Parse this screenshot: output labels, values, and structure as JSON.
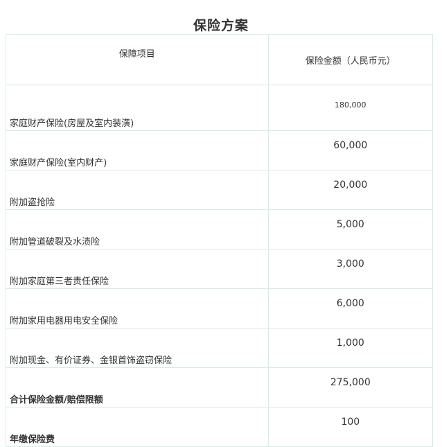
{
  "title": "保险方案",
  "table": {
    "header": {
      "item": "保障项目",
      "amount": "保险金额（人民币元）"
    },
    "rows": [
      {
        "item": "家庭财产保险(房屋及室内装潢)",
        "amount": "180,000",
        "bold": false
      },
      {
        "item": "家庭财产保险(室内财产)",
        "amount": "60,000",
        "bold": false
      },
      {
        "item": "附加盗抢险",
        "amount": "20,000",
        "bold": false
      },
      {
        "item": "附加管道破裂及水渍险",
        "amount": "5,000",
        "bold": false
      },
      {
        "item": "附加家庭第三者责任保险",
        "amount": "3,000",
        "bold": false
      },
      {
        "item": "附加家用电器用电安全保险",
        "amount": "6,000",
        "bold": false
      },
      {
        "item": "附加现金、有价证券、金银首饰盗窃保险",
        "amount": "1,000",
        "bold": false
      },
      {
        "item": "合计保险金额/赔偿限额",
        "amount": "275,000",
        "bold": true
      },
      {
        "item": "年缴保险费",
        "amount": "100",
        "bold": true
      }
    ]
  }
}
